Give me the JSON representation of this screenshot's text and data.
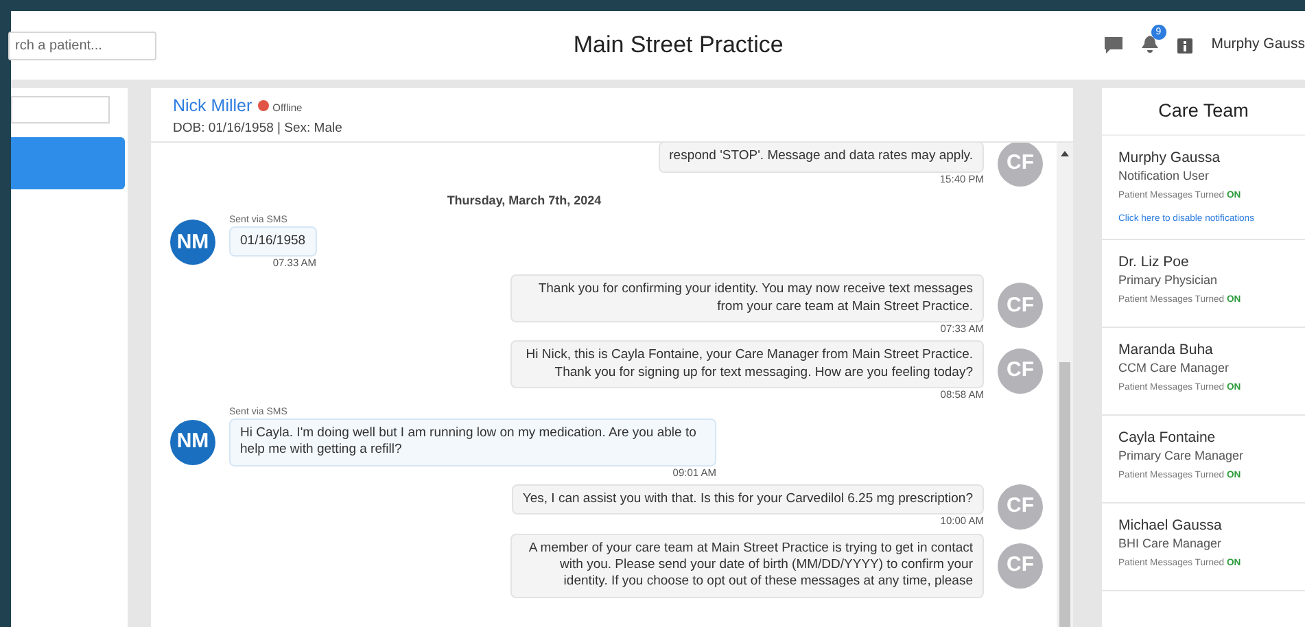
{
  "header": {
    "search": {
      "placeholder": "rch a patient..."
    },
    "title": "Main Street Practice",
    "notification_count": "9",
    "user": "Murphy Gauss"
  },
  "patient": {
    "name": "Nick Miller",
    "online": false,
    "status": "Offline",
    "details": "DOB: 01/16/1958 | Sex: Male"
  },
  "messages": [
    {
      "kind": "outgoing",
      "text": "respond 'STOP'. Message and data rates may apply.",
      "time": "15:40 PM",
      "initials": "CF"
    },
    {
      "kind": "date",
      "text": "Thursday, March 7th, 2024"
    },
    {
      "kind": "incoming",
      "via": "Sent via SMS",
      "text": "01/16/1958",
      "time": "07.33 AM",
      "initials": "NM"
    },
    {
      "kind": "outgoing",
      "text": "Thank you for confirming your identity. You may now receive text messages from your care team at Main Street Practice.",
      "time": "07:33 AM",
      "initials": "CF"
    },
    {
      "kind": "outgoing",
      "text": "Hi Nick, this is Cayla Fontaine, your Care Manager from Main Street Practice. Thank you for signing up for text messaging. How are you feeling today?",
      "time": "08:58 AM",
      "initials": "CF"
    },
    {
      "kind": "incoming",
      "via": "Sent via SMS",
      "text": "Hi Cayla. I'm doing well but I am running low on my medication. Are you able to help me with getting a refill?",
      "time": "09:01 AM",
      "initials": "NM"
    },
    {
      "kind": "outgoing",
      "text": "Yes, I can assist you with that. Is this for your Carvedilol 6.25 mg prescription?",
      "time": "10:00 AM",
      "initials": "CF"
    },
    {
      "kind": "outgoing",
      "text": "A member of your care team at Main Street Practice is trying to get in contact with you. Please send your date of birth (MM/DD/YYYY) to confirm your identity. If you choose to opt out of these messages at any time, please",
      "initials": "CF"
    }
  ],
  "care_team": {
    "title": "Care Team",
    "members": [
      {
        "name": "Murphy Gaussa",
        "role": "Notification User",
        "notice": "Patient Messages Turned",
        "notice_state": "ON",
        "link": "Click here to disable notifications"
      },
      {
        "name": "Dr. Liz Poe",
        "role": "Primary Physician",
        "notice": "Patient Messages Turned",
        "notice_state": "ON"
      },
      {
        "name": "Maranda Buha",
        "role": "CCM Care Manager",
        "notice": "Patient Messages Turned",
        "notice_state": "ON"
      },
      {
        "name": "Cayla Fontaine",
        "role": "Primary Care Manager",
        "notice": "Patient Messages Turned",
        "notice_state": "ON"
      },
      {
        "name": "Michael Gaussa",
        "role": "BHI Care Manager",
        "notice": "Patient Messages Turned",
        "notice_state": "ON"
      }
    ]
  }
}
